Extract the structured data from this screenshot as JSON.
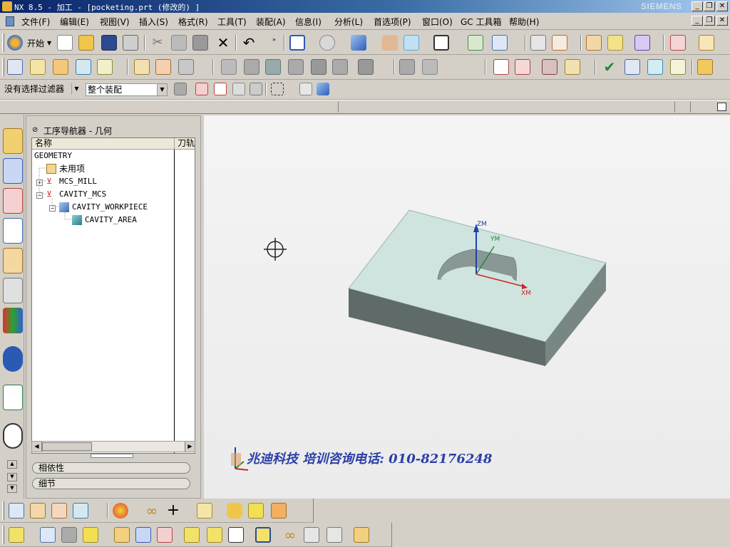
{
  "window": {
    "title": "NX 8.5 - 加工 - [pocketing.prt (修改的) ]",
    "brand": "SIEMENS",
    "controls": [
      "_",
      "❐",
      "✕"
    ]
  },
  "menu": {
    "items": [
      "文件(F)",
      "编辑(E)",
      "视图(V)",
      "插入(S)",
      "格式(R)",
      "工具(T)",
      "装配(A)",
      "信息(I)",
      "分析(L)",
      "首选项(P)",
      "窗口(O)",
      "GC 工具箱",
      "帮助(H)"
    ]
  },
  "toolbar1": {
    "start_label": "开始"
  },
  "selection_bar": {
    "filter_value": "没有选择过滤器",
    "scope_value": "整个装配"
  },
  "navigator": {
    "title": "工序导航器 - 几何",
    "col_name": "名称",
    "col_tool": "刀轨",
    "root": "GEOMETRY",
    "rows": [
      {
        "label": "未用项"
      },
      {
        "label": "MCS_MILL"
      },
      {
        "label": "CAVITY_MCS"
      },
      {
        "label": "CAVITY_WORKPIECE"
      },
      {
        "label": "CAVITY_AREA"
      }
    ],
    "section_dependencies": "相依性",
    "section_details": "细节"
  },
  "viewport": {
    "axis_zm": "ZM",
    "axis_ym": "YM",
    "axis_xm": "XM",
    "watermark": "兆迪科技 培训咨询电话: 010-82176248",
    "colors": {
      "part_top": "#cfe3df",
      "part_front": "#5f6b68",
      "part_side": "#788784",
      "axis_z": "#1f3fae",
      "axis_y": "#1f8a3a",
      "axis_x": "#c62828",
      "watermark": "#2a3fa8"
    }
  }
}
